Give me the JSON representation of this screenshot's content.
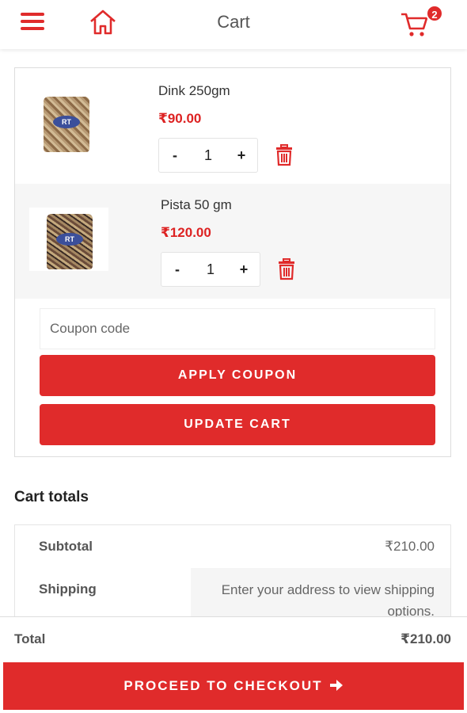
{
  "header": {
    "title": "Cart",
    "menu_icon": "hamburger-menu-icon",
    "home_icon": "home-icon",
    "cart_icon": "shopping-cart-icon",
    "cart_count": "2"
  },
  "cart": {
    "items": [
      {
        "name": "Dink 250gm",
        "price": "₹90.00",
        "quantity": "1",
        "image_label": "RT"
      },
      {
        "name": "Pista 50 gm",
        "price": "₹120.00",
        "quantity": "1",
        "image_label": "RT"
      }
    ],
    "qty_minus": "-",
    "qty_plus": "+",
    "coupon_placeholder": "Coupon code",
    "apply_coupon_label": "APPLY COUPON",
    "update_cart_label": "UPDATE CART"
  },
  "totals": {
    "heading": "Cart totals",
    "subtotal_label": "Subtotal",
    "subtotal_value": "₹210.00",
    "shipping_label": "Shipping",
    "shipping_text": "Enter your address to view shipping options.",
    "total_label": "Total",
    "total_value": "₹210.00"
  },
  "checkout": {
    "label": "PROCEED TO CHECKOUT"
  },
  "colors": {
    "accent": "#e02b2b",
    "price": "#dd2222"
  }
}
